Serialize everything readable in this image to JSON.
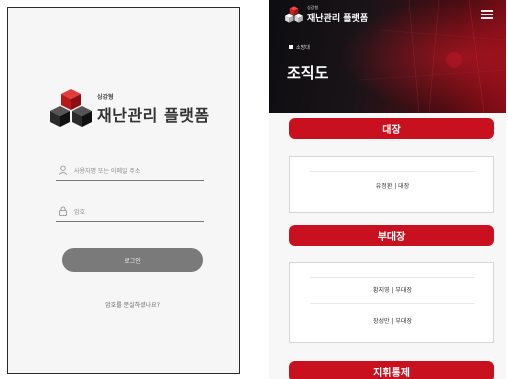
{
  "login": {
    "logo_small": "싱강형",
    "logo_big": "재난관리 플랫폼",
    "email_placeholder": "사용자명 또는 이메일 주소",
    "password_placeholder": "암호",
    "login_button": "로그인",
    "forgot_link": "암호를 분실하셨나요?"
  },
  "org": {
    "header": {
      "logo_small": "싱강형",
      "logo_big": "재난관리 플랫폼"
    },
    "breadcrumb": "소방대",
    "title": "조직도",
    "sections": [
      {
        "name": "대장",
        "members": [
          "유정환 | 대장"
        ]
      },
      {
        "name": "부대장",
        "members": [
          "황지영 | 부대장",
          "장성만 | 부대장"
        ]
      },
      {
        "name": "지휘통제",
        "members": []
      }
    ]
  },
  "colors": {
    "accent_red": "#c8101e",
    "button_gray": "#7a7a7a",
    "hero_dark": "#0d0d10"
  }
}
